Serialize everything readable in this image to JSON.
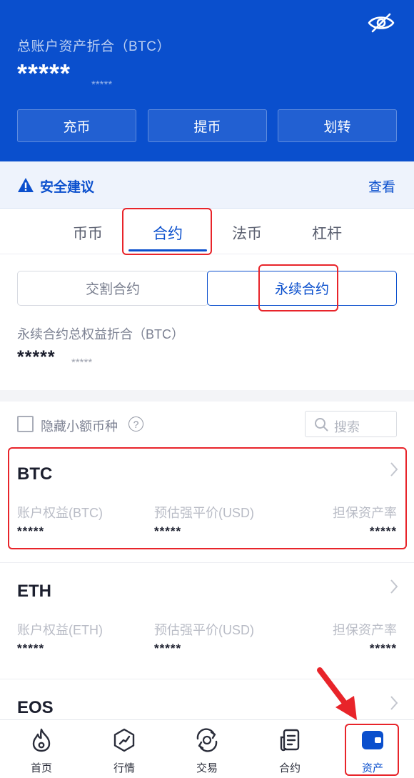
{
  "header": {
    "title": "总账户资产折合（BTC）",
    "balance": "*****",
    "balance_sub": "*****",
    "buttons": [
      "充币",
      "提币",
      "划转"
    ]
  },
  "security": {
    "title": "安全建议",
    "link": "查看"
  },
  "tabs": [
    "币币",
    "合约",
    "法币",
    "杠杆"
  ],
  "active_tab": "合约",
  "sub_tabs": [
    "交割合约",
    "永续合约"
  ],
  "active_sub_tab": "永续合约",
  "equity": {
    "label": "永续合约总权益折合（BTC）",
    "value": "*****",
    "sub": "*****"
  },
  "filter": {
    "hide_small_label": "隐藏小额币种",
    "help": "?",
    "search_placeholder": "搜索"
  },
  "coins": [
    {
      "name": "BTC",
      "col1_label": "账户权益(BTC)",
      "col2_label": "预估强平价(USD)",
      "col3_label": "担保资产率",
      "col1_value": "*****",
      "col2_value": "*****",
      "col3_value": "*****"
    },
    {
      "name": "ETH",
      "col1_label": "账户权益(ETH)",
      "col2_label": "预估强平价(USD)",
      "col3_label": "担保资产率",
      "col1_value": "*****",
      "col2_value": "*****",
      "col3_value": "*****"
    },
    {
      "name": "EOS"
    }
  ],
  "nav": [
    {
      "label": "首页",
      "icon": "fire-icon"
    },
    {
      "label": "行情",
      "icon": "market-icon"
    },
    {
      "label": "交易",
      "icon": "trade-icon"
    },
    {
      "label": "合约",
      "icon": "contract-icon"
    },
    {
      "label": "资产",
      "icon": "wallet-icon"
    }
  ],
  "active_nav": "资产",
  "colors": {
    "brand": "#0a4fcd",
    "highlight": "#e8242a"
  }
}
